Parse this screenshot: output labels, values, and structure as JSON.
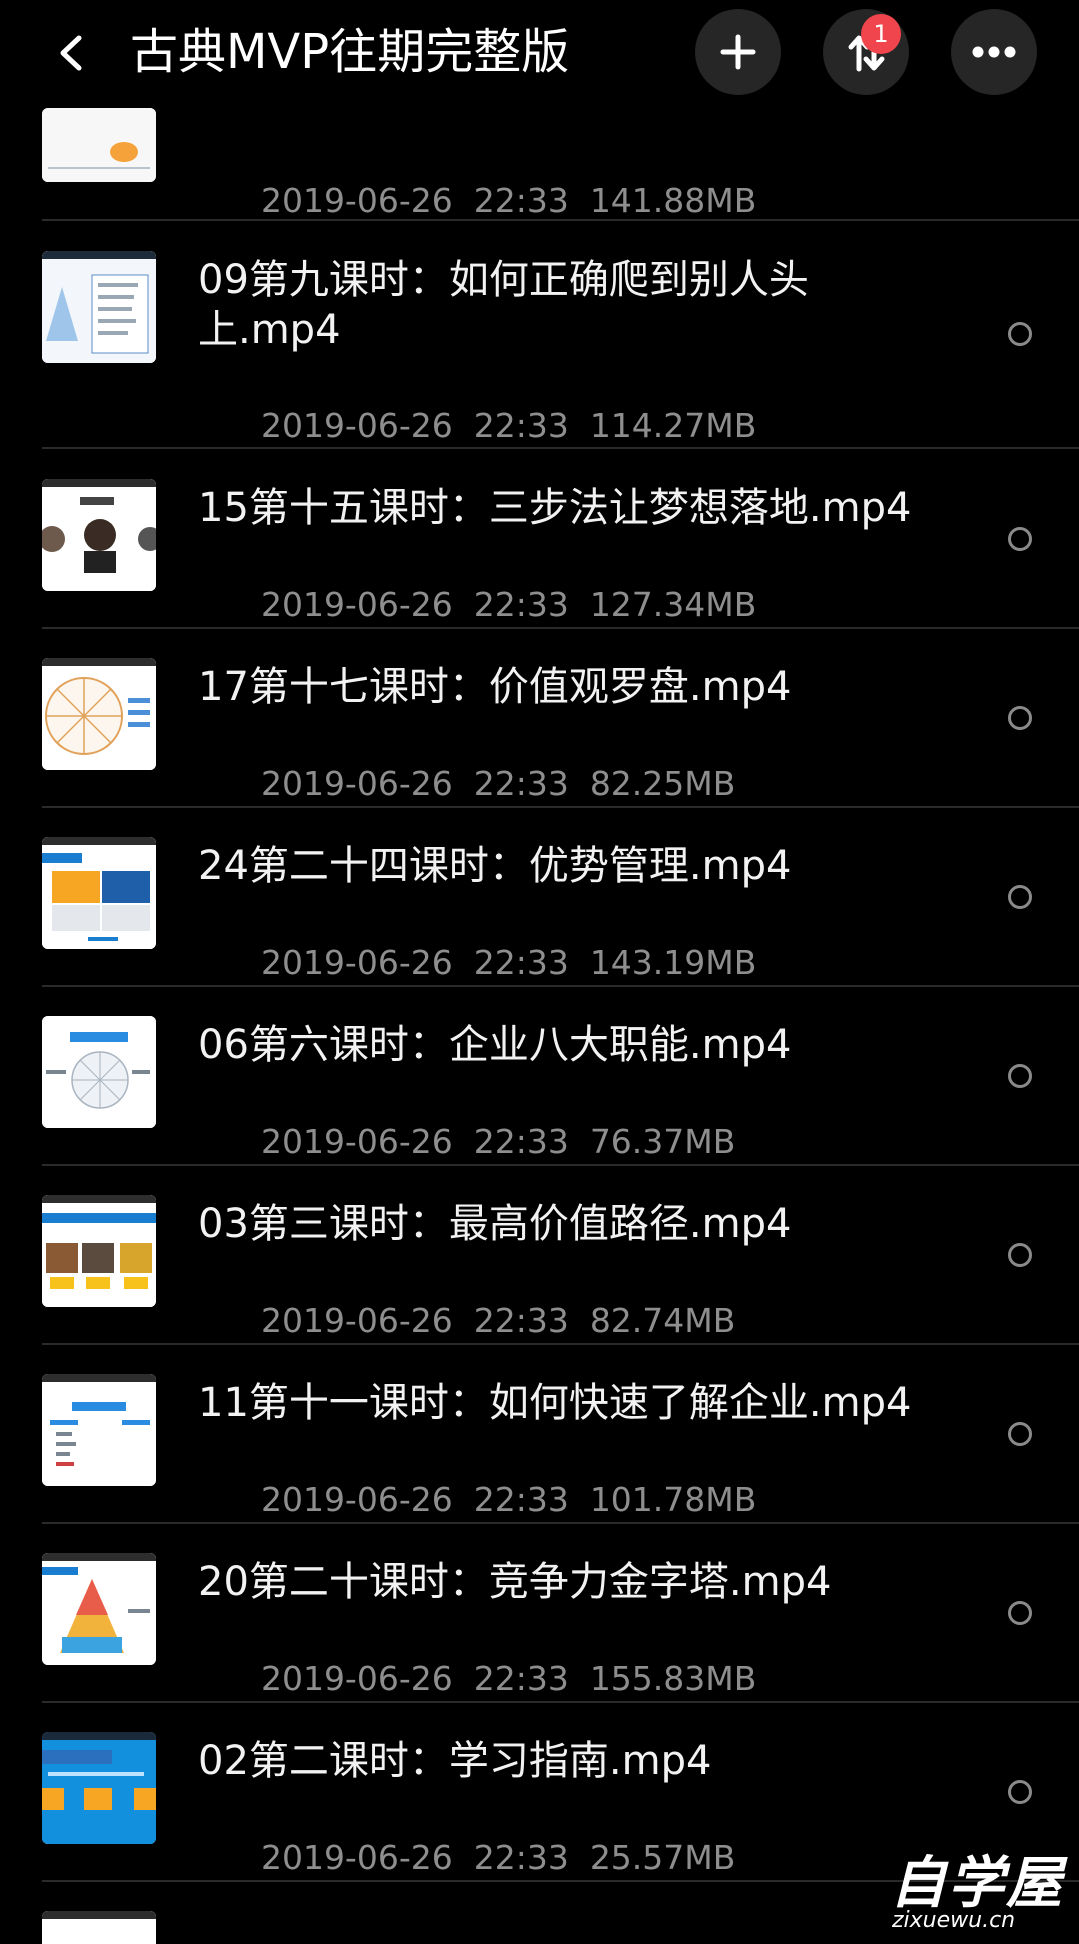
{
  "header": {
    "title": "古典MVP往期完整版",
    "back_icon": "chevron-left-icon",
    "add_icon": "plus-icon",
    "sort_icon": "sort-arrows-icon",
    "sort_badge": "1",
    "more_icon": "more-horizontal-icon"
  },
  "colors": {
    "background": "#000000",
    "button_bg": "#262626",
    "badge": "#f0454c",
    "meta_text": "#8e8e8e",
    "divider": "#2a2a2a"
  },
  "files": [
    {
      "name": "",
      "date": "2019-06-26",
      "time": "22:33",
      "size": "141.88MB"
    },
    {
      "name": "09第九课时：如何正确爬到别人头上.mp4",
      "date": "2019-06-26",
      "time": "22:33",
      "size": "114.27MB"
    },
    {
      "name": "15第十五课时：三步法让梦想落地.mp4",
      "date": "2019-06-26",
      "time": "22:33",
      "size": "127.34MB"
    },
    {
      "name": "17第十七课时：价值观罗盘.mp4",
      "date": "2019-06-26",
      "time": "22:33",
      "size": "82.25MB"
    },
    {
      "name": "24第二十四课时：优势管理.mp4",
      "date": "2019-06-26",
      "time": "22:33",
      "size": "143.19MB"
    },
    {
      "name": "06第六课时：企业八大职能.mp4",
      "date": "2019-06-26",
      "time": "22:33",
      "size": "76.37MB"
    },
    {
      "name": "03第三课时：最高价值路径.mp4",
      "date": "2019-06-26",
      "time": "22:33",
      "size": "82.74MB"
    },
    {
      "name": "11第十一课时：如何快速了解企业.mp4",
      "date": "2019-06-26",
      "time": "22:33",
      "size": "101.78MB"
    },
    {
      "name": "20第二十课时：竞争力金字塔.mp4",
      "date": "2019-06-26",
      "time": "22:33",
      "size": "155.83MB"
    },
    {
      "name": "02第二课时：学习指南.mp4",
      "date": "2019-06-26",
      "time": "22:33",
      "size": "25.57MB"
    }
  ],
  "partial_next_item": "",
  "watermark": {
    "brand": "自学屋",
    "domain": "zixuewu.cn"
  }
}
